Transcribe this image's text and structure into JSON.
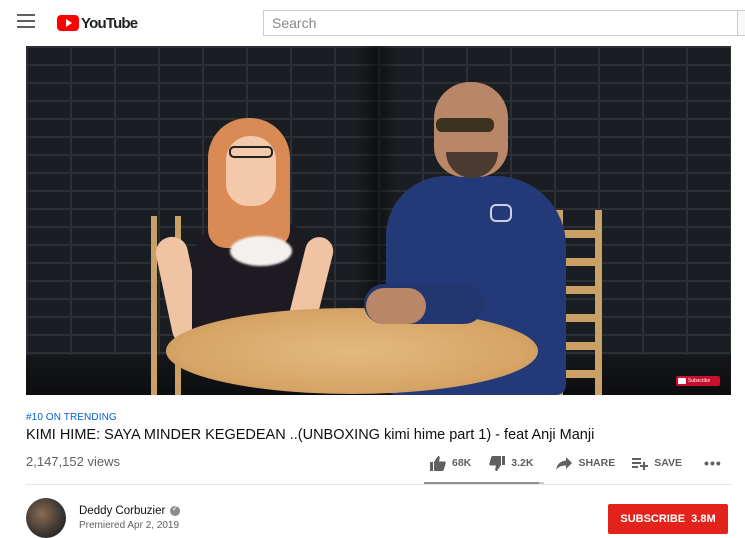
{
  "header": {
    "logo_text": "YouTube",
    "search_placeholder": "Search"
  },
  "video": {
    "watermark_text": "Subscribe",
    "trending_label": "#10 ON TRENDING",
    "title": "KIMI HIME: SAYA MINDER KEGEDEAN ..(UNBOXING kimi hime part 1) - feat Anji Manji",
    "views": "2,147,152 views",
    "like_ratio": 0.955
  },
  "actions": {
    "likes": "68K",
    "dislikes": "3.2K",
    "share_label": "SHARE",
    "save_label": "SAVE",
    "more_label": "•••"
  },
  "channel": {
    "name": "Deddy Corbuzier",
    "premiered": "Premiered Apr 2, 2019",
    "subscribe_label": "SUBSCRIBE",
    "subscriber_count": "3.8M"
  },
  "colors": {
    "accent_red": "#ff0000",
    "subscribe_red": "#e2221b",
    "trending_blue": "#065fd4"
  },
  "icons": [
    "menu-icon",
    "youtube-logo-icon",
    "thumbs-up-icon",
    "thumbs-down-icon",
    "share-icon",
    "playlist-add-icon",
    "more-icon",
    "verified-icon"
  ]
}
